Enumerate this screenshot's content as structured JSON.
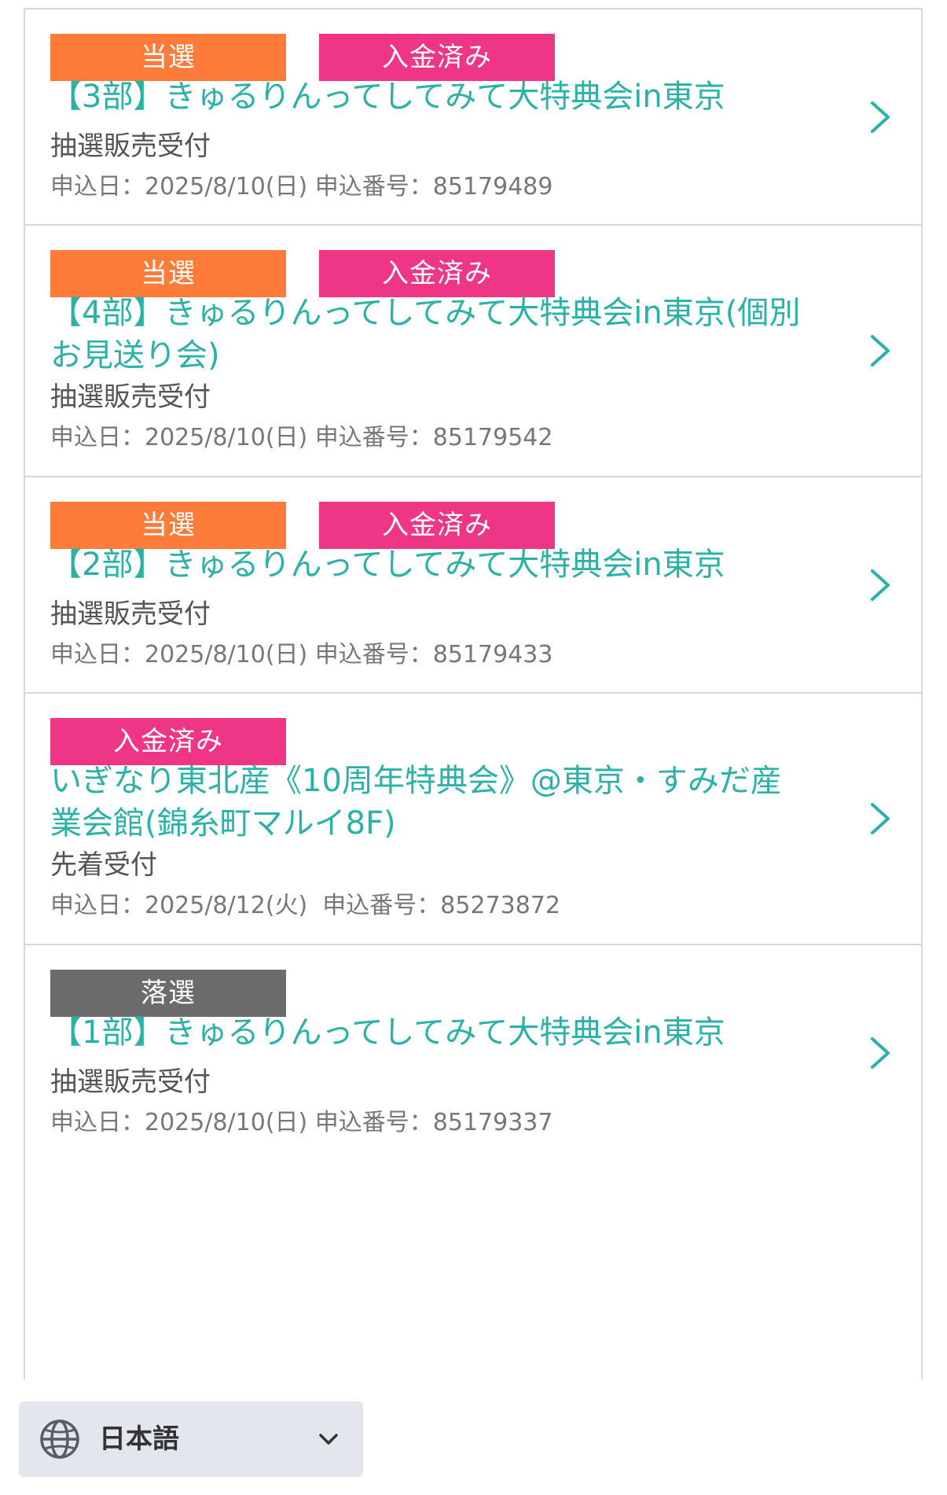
{
  "colors": {
    "accent_teal": "#2bb2a8",
    "won_orange": "#ff7b3a",
    "paid_pink": "#ef3585",
    "lost_gray": "#6b6b6b"
  },
  "items": [
    {
      "badges": [
        {
          "label": "当選",
          "kind": "won"
        },
        {
          "label": "入金済み",
          "kind": "paid"
        }
      ],
      "title": "【3部】きゅるりんってしてみて大特典会in東京",
      "type": "抽選販売受付",
      "meta": "申込日：2025/8/10(日) 申込番号：85179489"
    },
    {
      "badges": [
        {
          "label": "当選",
          "kind": "won"
        },
        {
          "label": "入金済み",
          "kind": "paid"
        }
      ],
      "title": "【4部】きゅるりんってしてみて大特典会in東京(個別\nお見送り会)",
      "type": "抽選販売受付",
      "meta": "申込日：2025/8/10(日) 申込番号：85179542"
    },
    {
      "badges": [
        {
          "label": "当選",
          "kind": "won"
        },
        {
          "label": "入金済み",
          "kind": "paid"
        }
      ],
      "title": "【2部】きゅるりんってしてみて大特典会in東京",
      "type": "抽選販売受付",
      "meta": "申込日：2025/8/10(日) 申込番号：85179433"
    },
    {
      "badges": [
        {
          "label": "入金済み",
          "kind": "paid"
        }
      ],
      "title": "いぎなり東北産《10周年特典会》@東京・すみだ産\n業会館(錦糸町マルイ8F)",
      "type": "先着受付",
      "meta": "申込日：2025/8/12(火)  申込番号：85273872"
    },
    {
      "badges": [
        {
          "label": "落選",
          "kind": "lost"
        }
      ],
      "title": "【1部】きゅるりんってしてみて大特典会in東京",
      "type": "抽選販売受付",
      "meta": "申込日：2025/8/10(日) 申込番号：85179337"
    }
  ],
  "language_selector": {
    "icon": "globe-icon",
    "label": "日本語",
    "dropdown_icon": "chevron-down-icon"
  }
}
